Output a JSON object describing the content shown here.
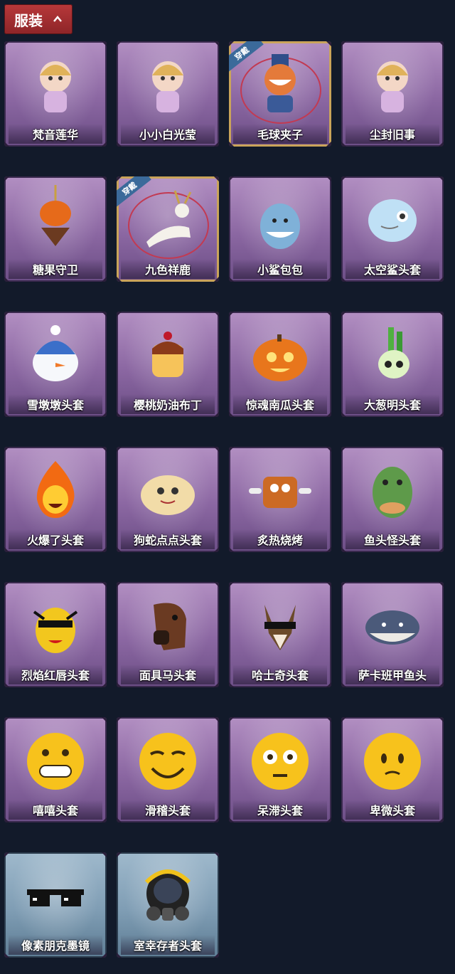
{
  "header": {
    "title": "服装"
  },
  "items": [
    {
      "label": "梵音莲华",
      "icon": "character-icon",
      "bg": "purple"
    },
    {
      "label": "小小白光莹",
      "icon": "character-icon",
      "bg": "purple"
    },
    {
      "label": "毛球夹子",
      "icon": "raccoon-icon",
      "bg": "purple",
      "equipped": true,
      "badge": "穿戴"
    },
    {
      "label": "尘封旧事",
      "icon": "character-icon",
      "bg": "purple"
    },
    {
      "label": "糖果守卫",
      "icon": "pumpkin-scarecrow-icon",
      "bg": "purple"
    },
    {
      "label": "九色祥鹿",
      "icon": "deer-icon",
      "bg": "purple",
      "equipped": true,
      "badge": "穿戴"
    },
    {
      "label": "小鲨包包",
      "icon": "shark-bag-icon",
      "bg": "purple"
    },
    {
      "label": "太空鲨头套",
      "icon": "shark-head-icon",
      "bg": "purple"
    },
    {
      "label": "雪墩墩头套",
      "icon": "snowman-head-icon",
      "bg": "purple"
    },
    {
      "label": "樱桃奶油布丁",
      "icon": "pudding-head-icon",
      "bg": "purple"
    },
    {
      "label": "惊魂南瓜头套",
      "icon": "pumpkin-head-icon",
      "bg": "purple"
    },
    {
      "label": "大葱明头套",
      "icon": "scallion-head-icon",
      "bg": "purple"
    },
    {
      "label": "火爆了头套",
      "icon": "fire-head-icon",
      "bg": "purple"
    },
    {
      "label": "狗蛇点点头套",
      "icon": "dog-snake-head-icon",
      "bg": "purple"
    },
    {
      "label": "炙热烧烤",
      "icon": "bbq-head-icon",
      "bg": "purple"
    },
    {
      "label": "鱼头怪头套",
      "icon": "fish-head-icon",
      "bg": "purple"
    },
    {
      "label": "烈焰红唇头套",
      "icon": "yellow-mask-icon",
      "bg": "purple"
    },
    {
      "label": "面具马头套",
      "icon": "horse-head-icon",
      "bg": "purple"
    },
    {
      "label": "哈士奇头套",
      "icon": "husky-head-icon",
      "bg": "purple"
    },
    {
      "label": "萨卡班甲鱼头",
      "icon": "fish-blob-icon",
      "bg": "purple"
    },
    {
      "label": "嘻嘻头套",
      "icon": "grin-emoji-icon",
      "bg": "purple"
    },
    {
      "label": "滑稽头套",
      "icon": "smirk-emoji-icon",
      "bg": "purple"
    },
    {
      "label": "呆滞头套",
      "icon": "blank-emoji-icon",
      "bg": "purple"
    },
    {
      "label": "卑微头套",
      "icon": "shy-emoji-icon",
      "bg": "purple"
    },
    {
      "label": "像素朋克墨镜",
      "icon": "pixel-glasses-icon",
      "bg": "blue"
    },
    {
      "label": "室幸存者头套",
      "icon": "gas-mask-icon",
      "bg": "blue"
    }
  ]
}
